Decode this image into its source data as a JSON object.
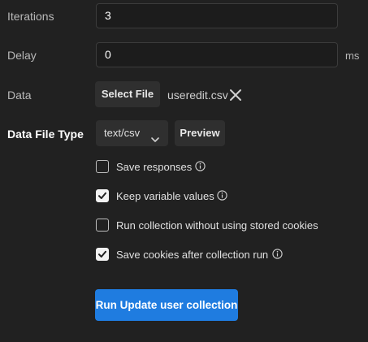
{
  "runner": {
    "iterations": {
      "label": "Iterations",
      "value": "3"
    },
    "delay": {
      "label": "Delay",
      "value": "0",
      "unit": "ms"
    },
    "data": {
      "label": "Data",
      "select_file_label": "Select File",
      "filename": "useredit.csv",
      "clear_icon": "close-icon"
    },
    "data_file_type": {
      "label": "Data File Type",
      "selected": "text/csv",
      "preview_label": "Preview"
    },
    "options": [
      {
        "label": "Save responses",
        "checked": false,
        "info": true
      },
      {
        "label": "Keep variable values",
        "checked": true,
        "info": true
      },
      {
        "label": "Run collection without using stored cookies",
        "checked": false,
        "info": false
      },
      {
        "label": "Save cookies after collection run",
        "checked": true,
        "info": true
      }
    ],
    "run_button_label": "Run Update user collection"
  },
  "colors": {
    "background": "#212121",
    "accent": "#1f7ce0",
    "button_bg": "#2f2f2f"
  }
}
